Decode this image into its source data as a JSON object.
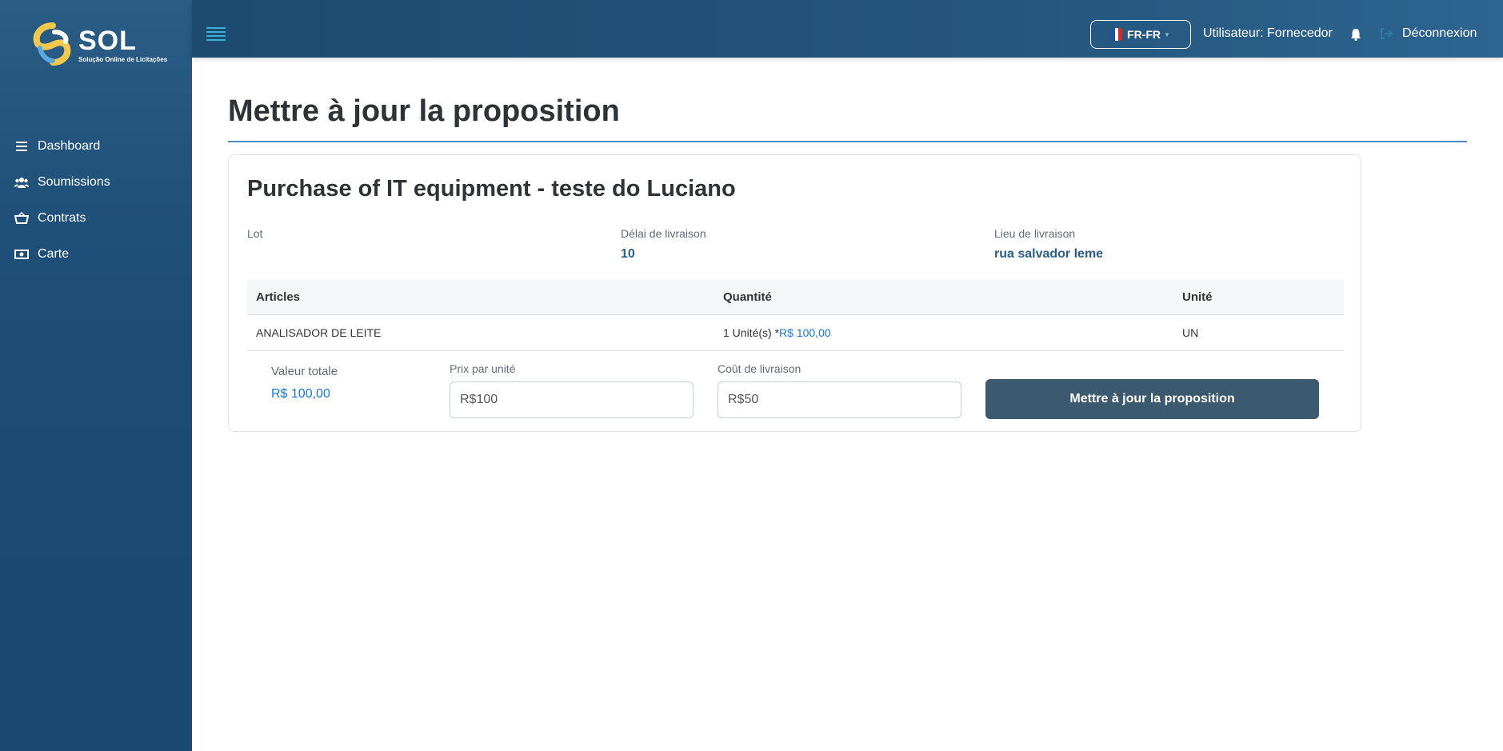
{
  "brand": {
    "name": "SOL",
    "tagline": "Solução Online de Licitações",
    "colors": {
      "sidebar": "#1f5079",
      "accent": "#3ab0d6",
      "link": "#1a73e8",
      "button": "#3c5a6f"
    }
  },
  "sidebar": {
    "items": [
      {
        "label": "Dashboard",
        "icon": "list-icon"
      },
      {
        "label": "Soumissions",
        "icon": "users-icon"
      },
      {
        "label": "Contrats",
        "icon": "basket-icon"
      },
      {
        "label": "Carte",
        "icon": "money-icon"
      }
    ]
  },
  "header": {
    "language": "FR-FR",
    "user": "Utilisateur: Fornecedor",
    "logout": "Déconnexion"
  },
  "page": {
    "title": "Mettre à jour la proposition"
  },
  "proposal": {
    "title": "Purchase of IT equipment - teste do Luciano",
    "lot_label": "Lot",
    "lot_value": "",
    "delivery_time_label": "Délai de livraison",
    "delivery_time_value": "10",
    "delivery_place_label": "Lieu de livraison",
    "delivery_place_value": "rua salvador leme",
    "table": {
      "headers": [
        "Articles",
        "Quantité",
        "Unité"
      ],
      "rows": [
        {
          "article": "ANALISADOR DE LEITE",
          "quantity": "1 Unité(s) *",
          "unit_price": "R$ 100,00",
          "unit": "UN"
        }
      ]
    },
    "total_label": "Valeur totale",
    "total_value": "R$ 100,00",
    "unit_price_label": "Prix par unité",
    "unit_price_value": "R$100",
    "delivery_cost_label": "Coût de livraison",
    "delivery_cost_value": "R$50",
    "submit_label": "Mettre à jour la proposition"
  }
}
